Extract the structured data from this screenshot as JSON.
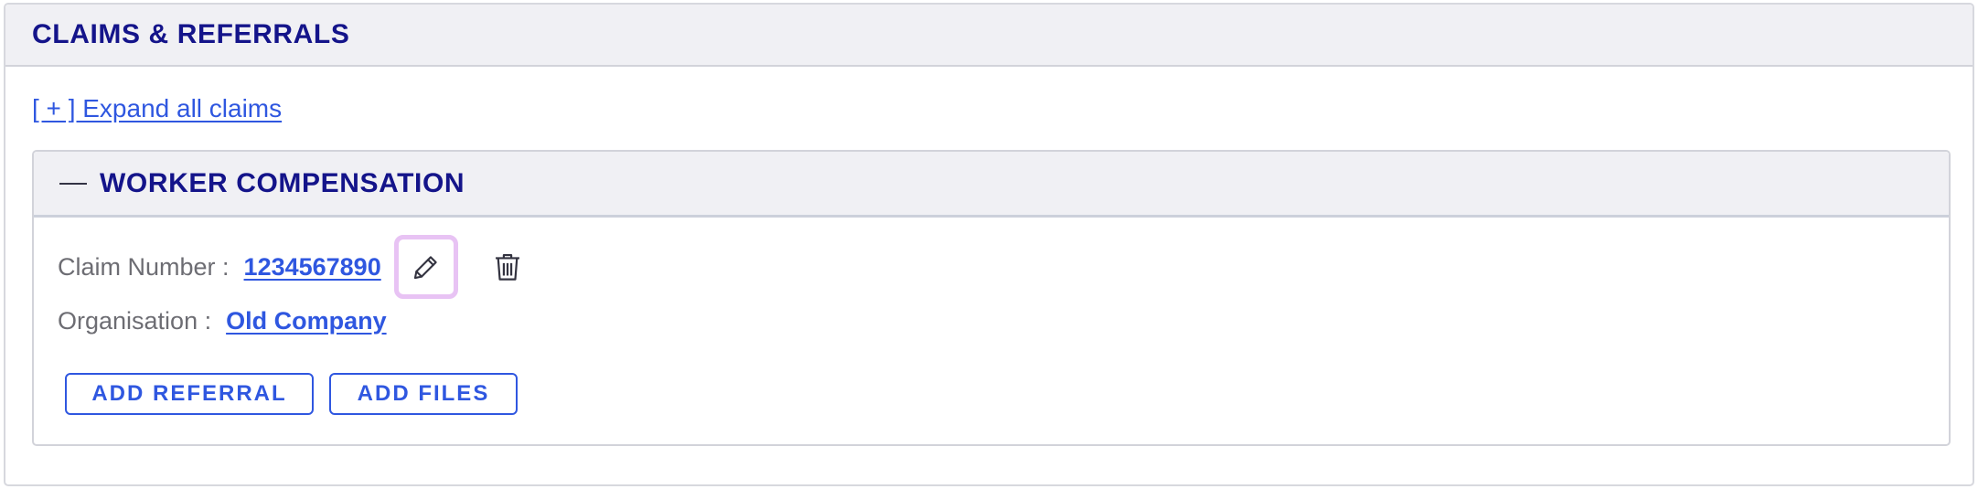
{
  "section": {
    "title": "CLAIMS & REFERRALS",
    "expand_link": "[ + ] Expand all claims"
  },
  "claim": {
    "title": "WORKER COMPENSATION",
    "toggle_icon": "minus-icon",
    "claim_number_label": "Claim Number :",
    "claim_number": "1234567890",
    "organisation_label": "Organisation :",
    "organisation": "Old Company",
    "edit_icon": "pencil-icon",
    "delete_icon": "trash-icon",
    "add_referral_label": "ADD REFERRAL",
    "add_files_label": "ADD FILES"
  },
  "colors": {
    "title": "#14148a",
    "link": "#2f57e0",
    "header_bg": "#f0f0f4",
    "edit_highlight": "#e8c3f4"
  }
}
